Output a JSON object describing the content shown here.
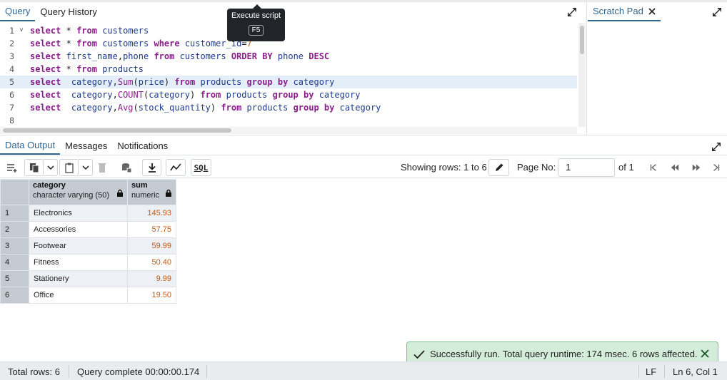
{
  "editor_tabs": {
    "query": "Query",
    "history": "Query History"
  },
  "scratch_pad": {
    "label": "Scratch Pad"
  },
  "tooltip": {
    "title": "Execute script",
    "shortcut": "F5"
  },
  "code_lines": [
    {
      "n": "1",
      "text": "select * from customers"
    },
    {
      "n": "2",
      "text": "select * from customers where customer_id=7"
    },
    {
      "n": "3",
      "text": "select first_name,phone from customers ORDER BY phone DESC"
    },
    {
      "n": "4",
      "text": "select * from products"
    },
    {
      "n": "5",
      "text": "select  category,Sum(price) from products group by category"
    },
    {
      "n": "6",
      "text": "select  category,COUNT(category) from products group by category"
    },
    {
      "n": "7",
      "text": "select  category,Avg(stock_quantity) from products group by category"
    },
    {
      "n": "8",
      "text": ""
    }
  ],
  "output_tabs": {
    "data": "Data Output",
    "messages": "Messages",
    "notifications": "Notifications"
  },
  "toolbar": {
    "showing": "Showing rows: 1 to 6",
    "page_label": "Page No:",
    "page_value": "1",
    "of_label": "of 1",
    "sql_label": "SQL"
  },
  "columns": [
    {
      "name": "category",
      "type": "character varying (50)"
    },
    {
      "name": "sum",
      "type": "numeric"
    }
  ],
  "rows": [
    {
      "n": "1",
      "category": "Electronics",
      "sum": "145.93"
    },
    {
      "n": "2",
      "category": "Accessories",
      "sum": "57.75"
    },
    {
      "n": "3",
      "category": "Footwear",
      "sum": "59.99"
    },
    {
      "n": "4",
      "category": "Fitness",
      "sum": "50.40"
    },
    {
      "n": "5",
      "category": "Stationery",
      "sum": "9.99"
    },
    {
      "n": "6",
      "category": "Office",
      "sum": "19.50"
    }
  ],
  "toast": {
    "message": "Successfully run. Total query runtime: 174 msec. 6 rows affected."
  },
  "status": {
    "total_rows": "Total rows: 6",
    "query_complete": "Query complete 00:00:00.174",
    "eol": "LF",
    "position": "Ln 6, Col 1"
  },
  "colors": {
    "accent": "#326690",
    "keyword": "#8b1d8b",
    "identifier": "#1e3b8a",
    "number": "#c05a18",
    "success_bg": "#d4edda"
  }
}
